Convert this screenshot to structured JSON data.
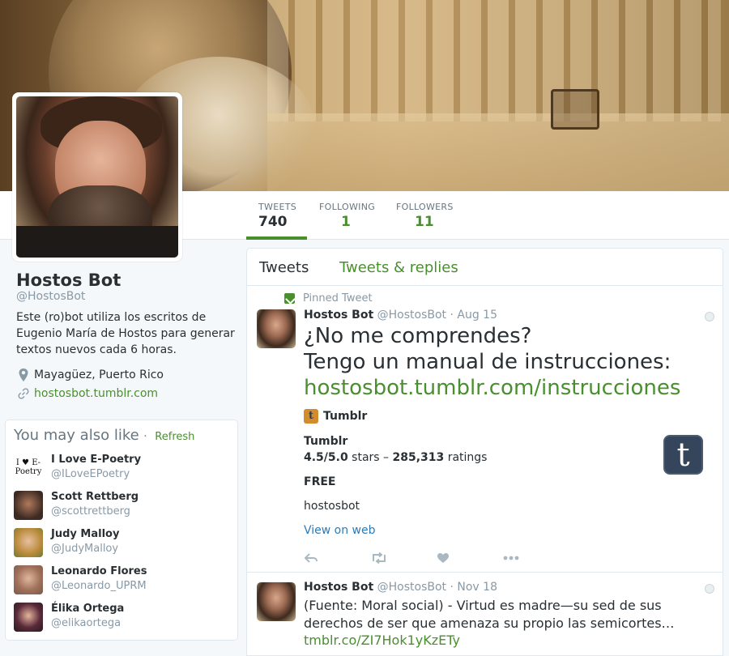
{
  "profile": {
    "name": "Hostos Bot",
    "handle": "@HostosBot",
    "bio": "Este (ro)bot utiliza los escritos de Eugenio María de Hostos para generar textos nuevos cada 6 horas.",
    "location": "Mayagüez, Puerto Rico",
    "url": "hostosbot.tumblr.com"
  },
  "nav": [
    {
      "label": "TWEETS",
      "value": "740"
    },
    {
      "label": "FOLLOWING",
      "value": "1"
    },
    {
      "label": "FOLLOWERS",
      "value": "11"
    }
  ],
  "wtf": {
    "title": "You may also like",
    "separator": "·",
    "refresh": "Refresh",
    "items": [
      {
        "name": "I Love E-Poetry",
        "handle": "@ILoveEPoetry",
        "avatar_text": "I ♥ E-Poetry"
      },
      {
        "name": "Scott Rettberg",
        "handle": "@scottrettberg"
      },
      {
        "name": "Judy Malloy",
        "handle": "@JudyMalloy"
      },
      {
        "name": "Leonardo Flores",
        "handle": "@Leonardo_UPRM"
      },
      {
        "name": "Élika Ortega",
        "handle": "@elikaortega"
      }
    ]
  },
  "timeline": {
    "tab_active": "Tweets",
    "tab_other": "Tweets & replies",
    "pinned_label": "Pinned Tweet",
    "tweet1": {
      "name": "Hostos Bot",
      "handle": "@HostosBot",
      "time": "· Aug 15",
      "line1": "¿No me comprendes?",
      "line2": "Tengo un manual de instrucciones:",
      "link": "hostosbot.tumblr.com/instrucciones",
      "card_source": "Tumblr",
      "card_title": "Tumblr",
      "rating": "4.5/5.0",
      "rating_mid": " stars – ",
      "ratings_count": "285,313",
      "ratings_word": " ratings",
      "price": "FREE",
      "developer": "hostosbot",
      "view_web": "View on web"
    },
    "tweet2": {
      "name": "Hostos Bot",
      "handle": "@HostosBot",
      "time": "· Nov 18",
      "text": "(Fuente: Moral social) - Virtud es madre—su sed de sus derechos de ser que amenaza su propio las semicortes…",
      "link": "tmblr.co/ZI7Hok1yKzETy"
    }
  },
  "colors": {
    "accent": "#4a8f2f",
    "text": "#292f33",
    "muted": "#8899a6"
  }
}
